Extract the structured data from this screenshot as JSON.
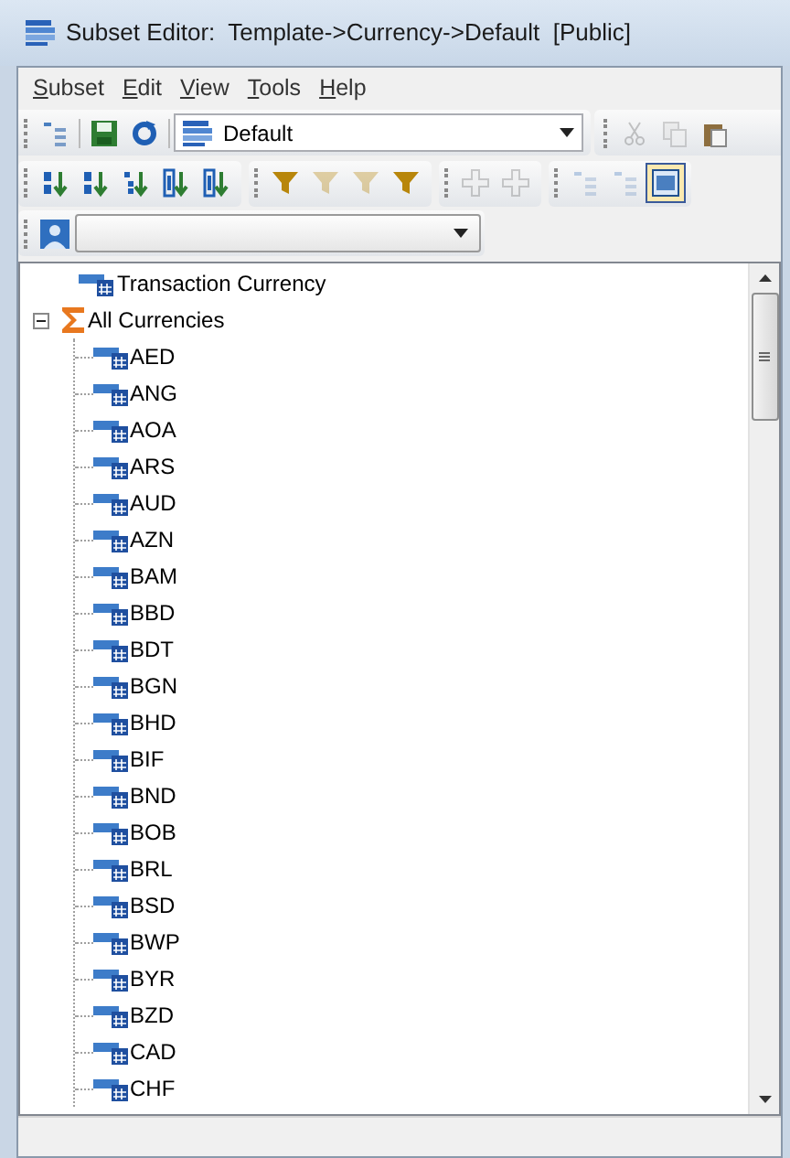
{
  "window": {
    "title": "Subset Editor:  Template->Currency->Default  [Public]"
  },
  "menu": [
    {
      "mnemonic": "S",
      "rest": "ubset"
    },
    {
      "mnemonic": "E",
      "rest": "dit"
    },
    {
      "mnemonic": "V",
      "rest": "iew"
    },
    {
      "mnemonic": "T",
      "rest": "ools"
    },
    {
      "mnemonic": "H",
      "rest": "elp"
    }
  ],
  "toolbar_1": {
    "buttons": [
      {
        "kind": "tree",
        "disabled": false
      },
      {
        "kind": "save",
        "disabled": false
      },
      {
        "kind": "refresh",
        "disabled": false
      }
    ],
    "subset_combo": {
      "value": "Default"
    },
    "edit_buttons": [
      {
        "kind": "cut",
        "disabled": true
      },
      {
        "kind": "copy",
        "disabled": true
      },
      {
        "kind": "paste",
        "disabled": false
      }
    ]
  },
  "toolbar_2": {
    "groups": [
      [
        {
          "kind": "sort-az",
          "disabled": false,
          "selected": false
        },
        {
          "kind": "sort-za",
          "disabled": false,
          "selected": false
        },
        {
          "kind": "sort-hier",
          "disabled": false,
          "selected": false
        },
        {
          "kind": "sort-index",
          "disabled": false,
          "selected": false
        },
        {
          "kind": "sort-index",
          "disabled": false,
          "selected": false
        }
      ],
      [
        {
          "kind": "filter",
          "disabled": false,
          "selected": false
        },
        {
          "kind": "filter",
          "disabled": true,
          "selected": false
        },
        {
          "kind": "filter",
          "disabled": true,
          "selected": false
        },
        {
          "kind": "filter",
          "disabled": false,
          "selected": false
        }
      ],
      [
        {
          "kind": "expand",
          "disabled": true,
          "selected": false
        },
        {
          "kind": "expand",
          "disabled": true,
          "selected": false
        }
      ],
      [
        {
          "kind": "tree",
          "disabled": true,
          "selected": false
        },
        {
          "kind": "tree",
          "disabled": true,
          "selected": false
        },
        {
          "kind": "window",
          "disabled": false,
          "selected": true
        }
      ]
    ]
  },
  "tree": [
    {
      "label": "Transaction Currency",
      "kind": "element"
    },
    {
      "label": "All Currencies",
      "kind": "consolidated",
      "expanded": true,
      "children": [
        {
          "label": "AED",
          "kind": "element"
        },
        {
          "label": "ANG",
          "kind": "element"
        },
        {
          "label": "AOA",
          "kind": "element"
        },
        {
          "label": "ARS",
          "kind": "element"
        },
        {
          "label": "AUD",
          "kind": "element"
        },
        {
          "label": "AZN",
          "kind": "element"
        },
        {
          "label": "BAM",
          "kind": "element"
        },
        {
          "label": "BBD",
          "kind": "element"
        },
        {
          "label": "BDT",
          "kind": "element"
        },
        {
          "label": "BGN",
          "kind": "element"
        },
        {
          "label": "BHD",
          "kind": "element"
        },
        {
          "label": "BIF",
          "kind": "element"
        },
        {
          "label": "BND",
          "kind": "element"
        },
        {
          "label": "BOB",
          "kind": "element"
        },
        {
          "label": "BRL",
          "kind": "element"
        },
        {
          "label": "BSD",
          "kind": "element"
        },
        {
          "label": "BWP",
          "kind": "element"
        },
        {
          "label": "BYR",
          "kind": "element"
        },
        {
          "label": "BZD",
          "kind": "element"
        },
        {
          "label": "CAD",
          "kind": "element"
        },
        {
          "label": "CHF",
          "kind": "element"
        }
      ]
    }
  ]
}
